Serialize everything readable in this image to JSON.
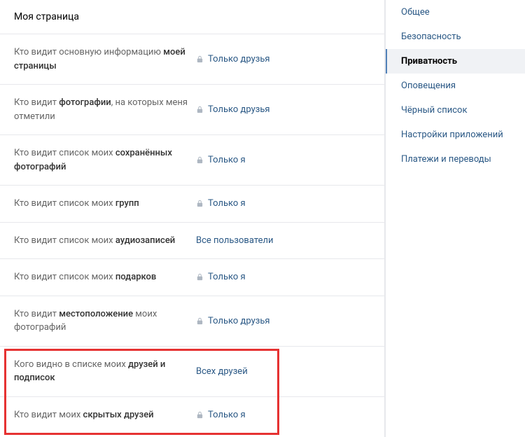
{
  "section_title": "Моя страница",
  "settings": [
    {
      "label_pre": "Кто видит основную информацию ",
      "label_bold": "моей страницы",
      "label_post": "",
      "value": "Только друзья",
      "locked": true
    },
    {
      "label_pre": "Кто видит ",
      "label_bold": "фотографии",
      "label_post": ", на которых меня отметили",
      "value": "Только друзья",
      "locked": true
    },
    {
      "label_pre": "Кто видит список моих ",
      "label_bold": "сохранённых фотографий",
      "label_post": "",
      "value": "Только я",
      "locked": true
    },
    {
      "label_pre": "Кто видит список моих ",
      "label_bold": "групп",
      "label_post": "",
      "value": "Только я",
      "locked": true
    },
    {
      "label_pre": "Кто видит список моих ",
      "label_bold": "аудиозаписей",
      "label_post": "",
      "value": "Все пользователи",
      "locked": false
    },
    {
      "label_pre": "Кто видит список моих ",
      "label_bold": "подарков",
      "label_post": "",
      "value": "Только я",
      "locked": true
    },
    {
      "label_pre": "Кто видит ",
      "label_bold": "местоположение",
      "label_post": " моих фотографий",
      "value": "Только друзья",
      "locked": true
    },
    {
      "label_pre": "Кого видно в списке моих ",
      "label_bold": "друзей и подписок",
      "label_post": "",
      "value": "Всех друзей",
      "locked": false
    },
    {
      "label_pre": "Кто видит моих ",
      "label_bold": "скрытых друзей",
      "label_post": "",
      "value": "Только я",
      "locked": true
    }
  ],
  "sidebar": {
    "items": [
      {
        "label": "Общее",
        "active": false
      },
      {
        "label": "Безопасность",
        "active": false
      },
      {
        "label": "Приватность",
        "active": true
      },
      {
        "label": "Оповещения",
        "active": false
      },
      {
        "label": "Чёрный список",
        "active": false
      },
      {
        "label": "Настройки приложений",
        "active": false
      },
      {
        "label": "Платежи и переводы",
        "active": false
      }
    ]
  }
}
